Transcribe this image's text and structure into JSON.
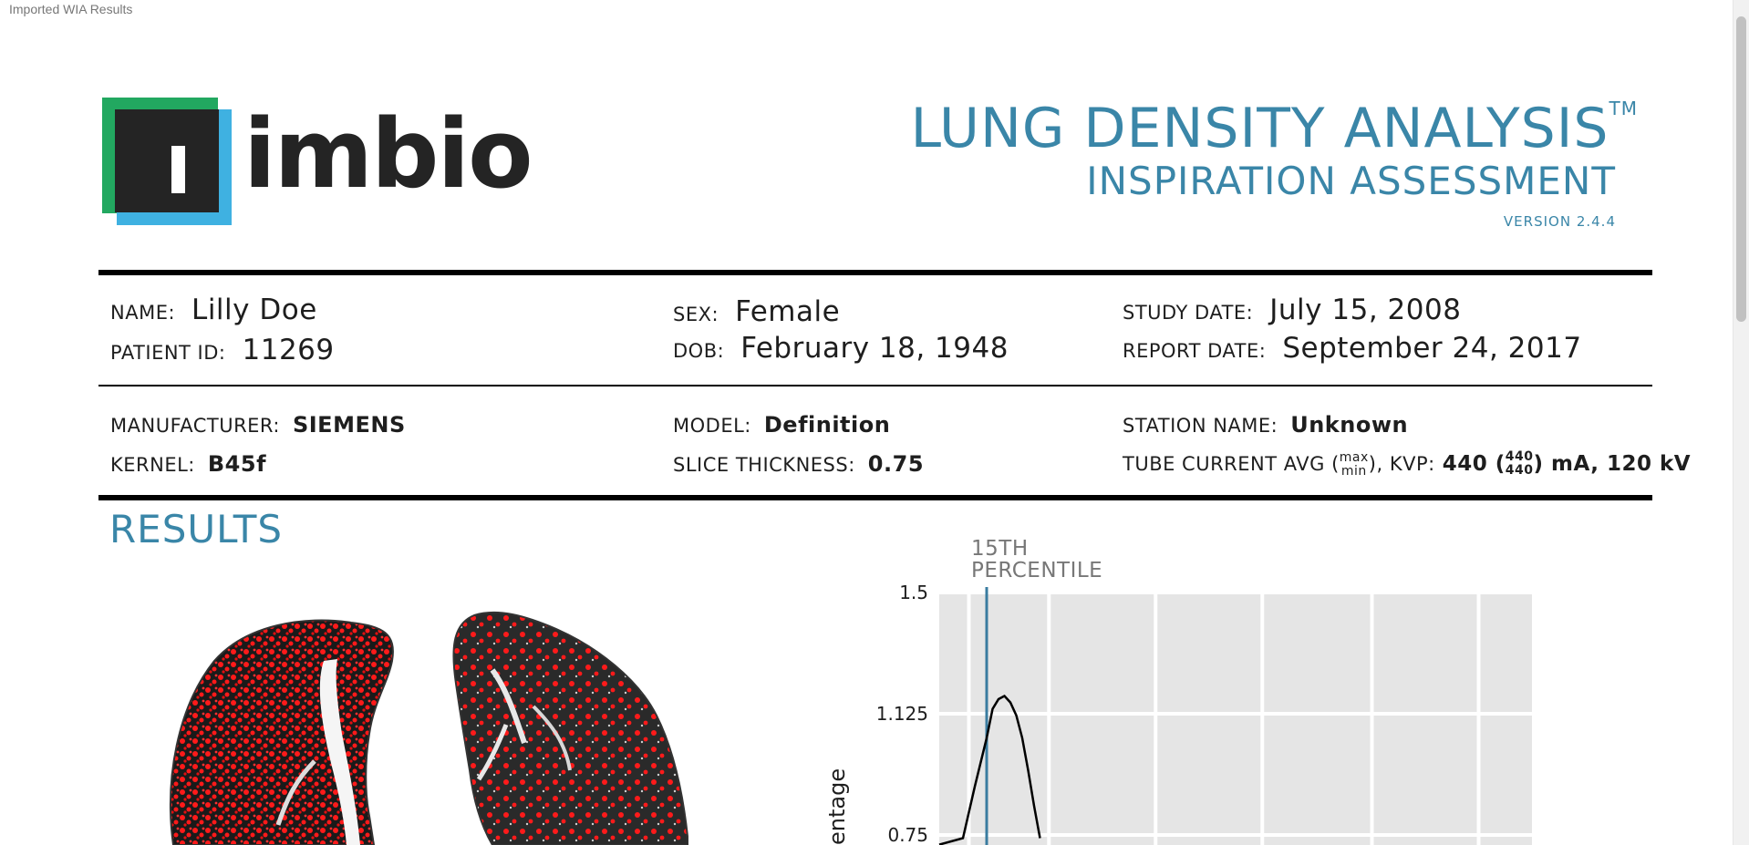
{
  "window": {
    "title": "Imported WIA Results"
  },
  "brand": {
    "logo_text": "imbio"
  },
  "header": {
    "title": "LUNG DENSITY ANALYSIS",
    "trademark": "TM",
    "subtitle": "INSPIRATION ASSESSMENT",
    "version": "VERSION 2.4.4"
  },
  "patient": {
    "name_label": "NAME:",
    "name": "Lilly Doe",
    "id_label": "PATIENT ID:",
    "id": "11269",
    "sex_label": "SEX:",
    "sex": "Female",
    "dob_label": "DOB:",
    "dob": "February 18, 1948",
    "study_date_label": "STUDY DATE:",
    "study_date": "July 15, 2008",
    "report_date_label": "REPORT DATE:",
    "report_date": "September 24, 2017"
  },
  "scan_info": {
    "manufacturer_label": "MANUFACTURER:",
    "manufacturer": "SIEMENS",
    "kernel_label": "KERNEL:",
    "kernel": "B45f",
    "model_label": "MODEL:",
    "model": "Definition",
    "slice_label": "SLICE THICKNESS:",
    "slice": "0.75",
    "station_label": "STATION NAME:",
    "station": "Unknown",
    "tube_label_prefix": "TUBE CURRENT AVG (",
    "tube_label_max": "max",
    "tube_label_min": "min",
    "tube_label_suffix": "), KVP:",
    "tube_value_prefix": "440 (",
    "tube_value_max": "440",
    "tube_value_min": "440",
    "tube_value_suffix": ") mA, 120 kV"
  },
  "results": {
    "heading": "RESULTS"
  },
  "chart_data": {
    "type": "line",
    "annotation": "15TH PERCENTILE",
    "annotation_x": 0.08,
    "ylabel": "entage",
    "y_ticks": [
      "1.5",
      "1.125",
      "0.75"
    ],
    "ylim": [
      0.75,
      1.5
    ],
    "xlim": [
      0,
      1
    ],
    "x": [
      0.0,
      0.04,
      0.06,
      0.08,
      0.09,
      0.1,
      0.11,
      0.12,
      0.13,
      0.14,
      0.15,
      0.16,
      0.17
    ],
    "y": [
      0.72,
      0.74,
      0.9,
      1.05,
      1.14,
      1.17,
      1.18,
      1.16,
      1.12,
      1.05,
      0.95,
      0.84,
      0.74
    ],
    "grid": true,
    "colors": {
      "background": "#e5e5e5",
      "grid": "#ffffff",
      "line": "#000000",
      "marker": "#3a7ca0"
    }
  }
}
